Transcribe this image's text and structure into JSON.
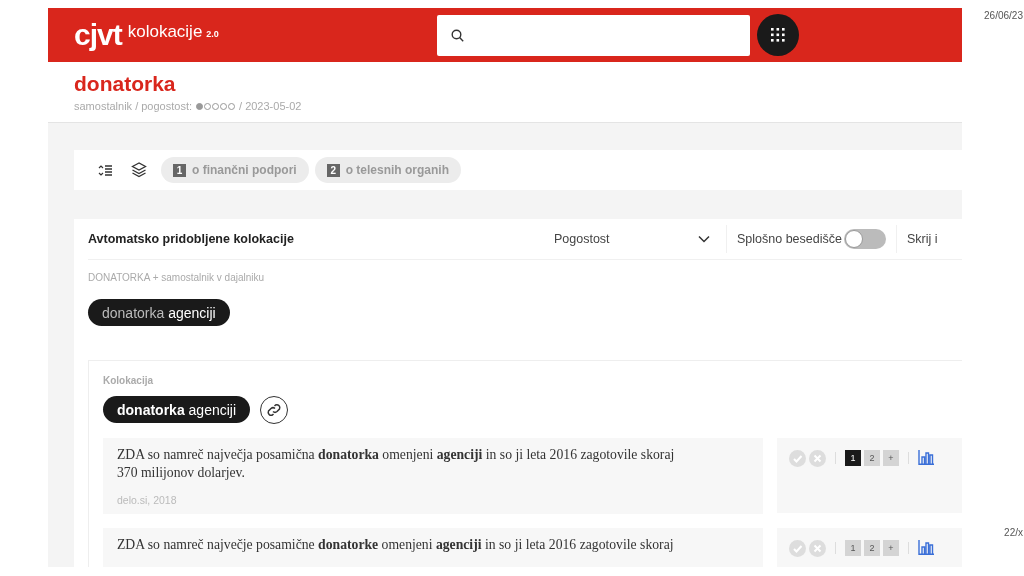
{
  "slide": {
    "date": "26/06/23",
    "page": "22/x"
  },
  "header": {
    "logo": "cjvt",
    "product": "kolokacije",
    "version": "2.0"
  },
  "entry": {
    "title": "donatorka",
    "meta_before": "samostalnik / pogostost:",
    "frequency": {
      "stars": 1
    },
    "meta_after": "/ 2023-05-02"
  },
  "toolbar": {
    "senses": [
      {
        "number": "1",
        "label": "o finančni podpori"
      },
      {
        "number": "2",
        "label": "o telesnih organih"
      }
    ]
  },
  "panel": {
    "title": "Avtomatsko pridobljene kolokacije",
    "sort": {
      "value": "Pogostost"
    },
    "general_vocabulary": {
      "label": "Splošno besedišče",
      "on": false
    },
    "hide_label": "Skrij i",
    "pattern": "DONATORKA + samostalnik v dajalniku",
    "pattern_chip": {
      "headword": "donatorka",
      "collocate": "agenciji"
    },
    "collocation": {
      "label": "Kolokacija",
      "chip": "**donatorka** agenciji",
      "examples": [
        {
          "text": "ZDA so namreč največja posamična **donatorka** omenjeni **agenciji** in so ji leta 2016 zagotovile skoraj 370 milijonov dolarjev.",
          "source": "delo.si, 2018",
          "senses": [
            {
              "label": "1",
              "selected": true
            },
            {
              "label": "2",
              "selected": false
            }
          ],
          "add": "+"
        },
        {
          "text": "ZDA so namreč največje posamične **donatorke** omenjeni **agenciji** in so ji leta 2016 zagotovile skoraj",
          "senses": [
            {
              "label": "1",
              "selected": false
            },
            {
              "label": "2",
              "selected": false
            }
          ],
          "add": "+"
        }
      ]
    }
  }
}
